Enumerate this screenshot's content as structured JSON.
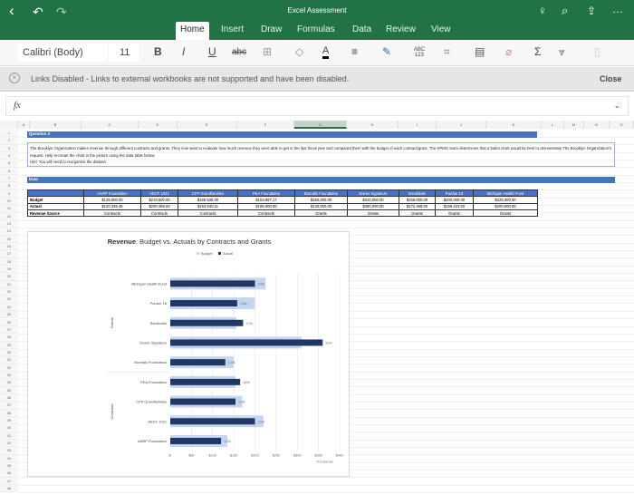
{
  "app": {
    "title": "Excel Assessment",
    "tabs": [
      "Home",
      "Insert",
      "Draw",
      "Formulas",
      "Data",
      "Review",
      "View"
    ],
    "active_tab": "Home"
  },
  "toolbar": {
    "font": "Calibri (Body)",
    "size": "11",
    "bold": "B",
    "italic": "I",
    "underline": "U",
    "strike": "abc",
    "spell": "ABC 123",
    "sum": "Σ"
  },
  "banner": {
    "message": "Links Disabled - Links to external workbooks are not supported and have been disabled.",
    "close": "Close"
  },
  "formula": {
    "fx": "fx",
    "value": ""
  },
  "columns": [
    "A",
    "B",
    "C",
    "D",
    "E",
    "F",
    "G",
    "H",
    "I",
    "J",
    "K",
    "L",
    "M",
    "N",
    "O"
  ],
  "selected_column": "G",
  "sheet": {
    "question_header": "Question 2",
    "question_text": "The Brooklyn Organization makes revenue through different contracts and grants. They now want to evaluate how much revenue they were able to get in the last fiscal year and compared them with the budget of each contract/grant. The KPMG team determines that a bullet chart would be best to demonstrate The Brooklyn Organization's request. Help recreate the chart in the picture using the data table below.",
    "hint": "Hint: You will need to reorganize the dataset",
    "data_header": "Data",
    "table": {
      "headers": [
        "AARP Foundation",
        "AECF 1021",
        "CFP Grandfamilies",
        "PEA Foundation",
        "Borealis Foundation",
        "Eisner Signature",
        "Brookdale",
        "Purdue 18",
        "Michigan Health Fund"
      ],
      "rows": [
        {
          "label": "Budget",
          "values": [
            "$135,000.00",
            "$219,500.00",
            "$169,538.00",
            "$153,897.17",
            "$150,000.00",
            "$310,000.00",
            "$156,000.00",
            "$200,000.00",
            "$225,000.00"
          ]
        },
        {
          "label": "Actual",
          "values": [
            "$120,336.45",
            "$200,488.63",
            "$153,540.11",
            "$165,000.00",
            "$130,000.00",
            "$360,000.00",
            "$172,468.00",
            "$158,423.00",
            "$200,000.00"
          ]
        },
        {
          "label": "Revenue Source",
          "values": [
            "Contracts",
            "Contracts",
            "Contracts",
            "Contracts",
            "Grants",
            "Grants",
            "Grants",
            "Grants",
            "Grants"
          ]
        }
      ]
    }
  },
  "chart_data": {
    "type": "bar",
    "orientation": "horizontal",
    "title_bold": "Revenue",
    "title_rest": ": Budget vs. Actuals by Contracts and Grants",
    "legend": [
      "Budget",
      "Actual"
    ],
    "categories": [
      "Michigan Health Fund",
      "Purdue 18",
      "Brookdale",
      "Eisner Signature",
      "Borealis Foundation",
      "PEA Foundation",
      "CFP Grandfamilies",
      "AECF 1021",
      "AARP Foundation"
    ],
    "groups": [
      {
        "name": "Grants",
        "count": 5
      },
      {
        "name": "Contracts",
        "count": 4
      }
    ],
    "series": [
      {
        "name": "Budget",
        "values": [
          225,
          200,
          156,
          310,
          150,
          154,
          170,
          220,
          135
        ]
      },
      {
        "name": "Actual",
        "values": [
          200,
          158,
          172,
          360,
          130,
          165,
          154,
          200,
          120
        ]
      }
    ],
    "data_labels": [
      "200k",
      "158k",
      "172k",
      "360k",
      "130k",
      "165k",
      "154k",
      "200k",
      "120k"
    ],
    "xticks": [
      "$-",
      "$50",
      "$100",
      "$150",
      "$200",
      "$250",
      "$300",
      "$350",
      "$400"
    ],
    "xlim": [
      0,
      400
    ],
    "xlabel": "Thousands",
    "colors": {
      "budget": "#c5d6f0",
      "actual": "#1f3864"
    }
  }
}
